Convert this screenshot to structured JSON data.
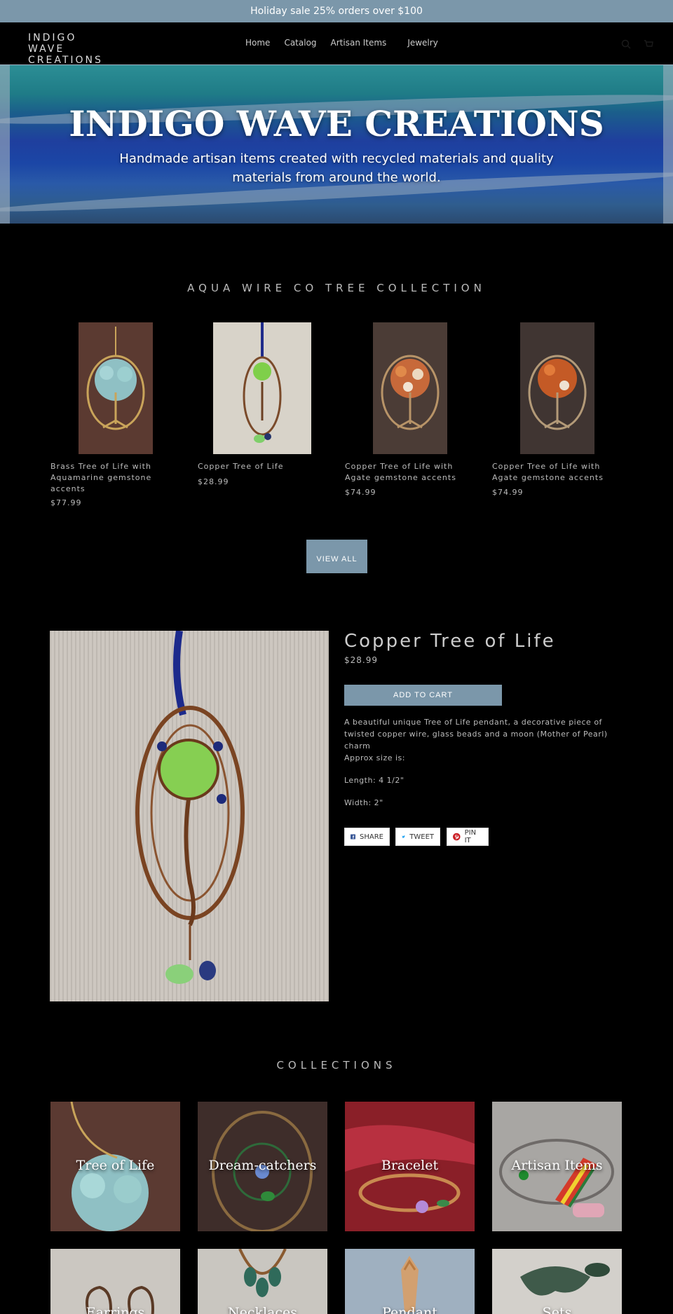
{
  "announcement": "Holiday sale 25% orders over $100",
  "header": {
    "logo_line1": "INDIGO WAVE",
    "logo_line2": "CREATIONS",
    "nav": [
      "Home",
      "Catalog",
      "Artisan Items",
      "Jewelry"
    ]
  },
  "hero": {
    "title": "INDIGO WAVE CREATIONS",
    "subtitle": "Handmade artisan items created with recycled materials and quality materials from around the world."
  },
  "featured_collection": {
    "title": "AQUA WIRE CO TREE COLLECTION",
    "products": [
      {
        "name": "Brass Tree of Life with Aquamarine gemstone accents",
        "price": "$77.99"
      },
      {
        "name": "Copper Tree of Life",
        "price": "$28.99"
      },
      {
        "name": "Copper Tree of Life with Agate gemstone accents",
        "price": "$74.99"
      },
      {
        "name": "Copper Tree of Life with Agate gemstone accents",
        "price": "$74.99"
      }
    ],
    "view_all": "VIEW ALL"
  },
  "featured_product": {
    "title": "Copper Tree of Life",
    "price": "$28.99",
    "add_to_cart": "ADD TO CART",
    "description": "A beautiful unique Tree of Life pendant, a decorative piece of twisted copper wire, glass beads and a moon (Mother of Pearl) charm",
    "size_label": "Approx size is:",
    "length": "Length: 4 1/2\"",
    "width": "Width: 2\""
  },
  "share": {
    "share": "SHARE",
    "tweet": "TWEET",
    "pin": "PIN IT"
  },
  "collections": {
    "title": "COLLECTIONS",
    "items": [
      "Tree of Life",
      "Dream-catchers",
      "Bracelet",
      "Artisan Items",
      "Earrings",
      "Necklaces",
      "Pendant",
      "Sets"
    ]
  },
  "colors": {
    "accent": "#7b97aa",
    "background": "#000000"
  }
}
